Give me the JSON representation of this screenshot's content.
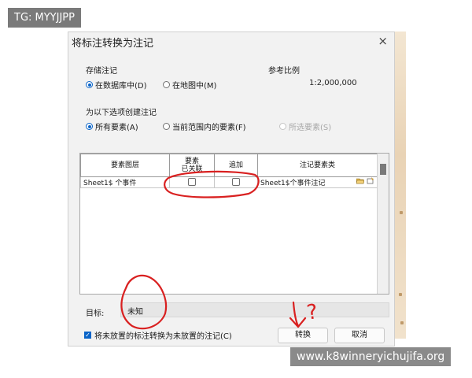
{
  "watermarks": {
    "top": "TG: MYYJJPP",
    "bottom": "www.k8winneryichujifa.org"
  },
  "dialog": {
    "title": "将标注转换为注记",
    "close_glyph": "×",
    "storage": {
      "label": "存储注记",
      "options": [
        {
          "label": "在数据库中(D)",
          "selected": true
        },
        {
          "label": "在地图中(M)",
          "selected": false
        }
      ]
    },
    "reference_scale": {
      "label": "参考比例",
      "value": "1:2,000,000"
    },
    "create_for": {
      "label": "为以下选项创建注记",
      "options": [
        {
          "label": "所有要素(A)",
          "selected": true,
          "enabled": true
        },
        {
          "label": "当前范围内的要素(F)",
          "selected": false,
          "enabled": true
        },
        {
          "label": "所选要素(S)",
          "selected": false,
          "enabled": false
        }
      ]
    },
    "grid": {
      "headers": [
        "要素图层",
        "要素\n已关联",
        "追加",
        "注记要素类"
      ],
      "rows": [
        {
          "layer": "Sheet1$ 个事件",
          "feature_linked": false,
          "append": false,
          "annotation_class": "Sheet1$个事件注记"
        }
      ]
    },
    "target": {
      "label": "目标:",
      "value": "未知"
    },
    "convert_unplaced": {
      "label": "将未放置的标注转换为未放置的注记(C)",
      "checked": true
    },
    "buttons": {
      "convert": "转换",
      "cancel": "取消"
    }
  },
  "annotation_marks": {
    "question": "?"
  },
  "colors": {
    "accent": "#0a64c8",
    "ink": "#d92020"
  }
}
